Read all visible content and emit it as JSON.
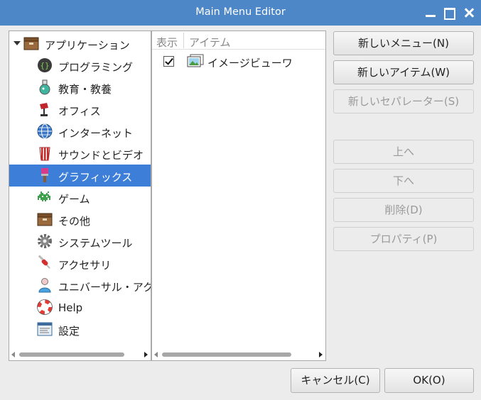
{
  "window": {
    "title": "Main Menu Editor"
  },
  "tree": {
    "root": {
      "label": "アプリケーション",
      "icon": "folder-icon"
    },
    "items": [
      {
        "label": "プログラミング",
        "icon": "programming-icon"
      },
      {
        "label": "教育・教養",
        "icon": "education-icon"
      },
      {
        "label": "オフィス",
        "icon": "office-icon"
      },
      {
        "label": "インターネット",
        "icon": "internet-globe-icon"
      },
      {
        "label": "サウンドとビデオ",
        "icon": "sound-video-icon"
      },
      {
        "label": "グラフィックス",
        "icon": "graphics-brush-icon",
        "selected": true
      },
      {
        "label": "ゲーム",
        "icon": "game-invader-icon"
      },
      {
        "label": "その他",
        "icon": "other-box-icon"
      },
      {
        "label": "システムツール",
        "icon": "system-tools-gear-icon"
      },
      {
        "label": "アクセサリ",
        "icon": "accessories-knife-icon"
      },
      {
        "label": "ユニバーサル・アクセス",
        "icon": "universal-access-icon"
      },
      {
        "label": "Help",
        "icon": "help-lifebuoy-icon"
      },
      {
        "label": "設定",
        "icon": "settings-icon"
      }
    ]
  },
  "items_panel": {
    "col_show": "表示",
    "col_item": "アイテム",
    "rows": [
      {
        "label": "イメージビューワ",
        "checked": true,
        "icon": "image-viewer-icon"
      }
    ]
  },
  "buttons": {
    "new_menu": "新しいメニュー(N)",
    "new_item": "新しいアイテム(W)",
    "new_separator": "新しいセパレーター(S)",
    "move_up": "上へ",
    "move_down": "下へ",
    "delete": "削除(D)",
    "properties": "プロパティ(P)",
    "cancel": "キャンセル(C)",
    "ok": "OK(O)"
  },
  "colors": {
    "titlebar": "#4d87c7",
    "selection": "#3d7ed8"
  }
}
